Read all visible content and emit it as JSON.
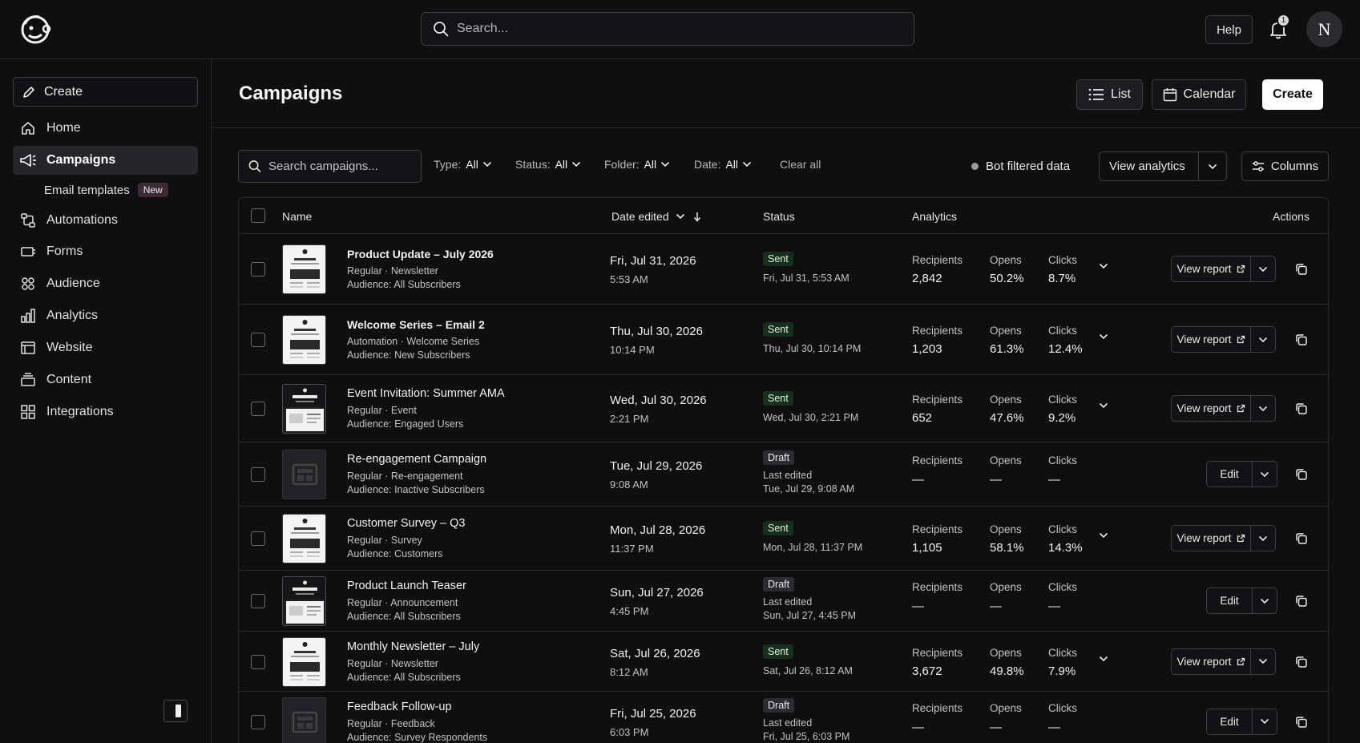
{
  "header": {
    "search_placeholder": "Search...",
    "help_label": "Help",
    "notification_count": "1",
    "avatar_initial": "N"
  },
  "sidebar": {
    "create_label": "Create",
    "items": [
      {
        "label": "Home",
        "icon": "home-icon"
      },
      {
        "label": "Campaigns",
        "icon": "megaphone-icon",
        "active": true
      },
      {
        "label": "Email templates",
        "badge": "New"
      },
      {
        "label": "Automations",
        "icon": "automation-icon"
      },
      {
        "label": "Forms",
        "icon": "form-icon"
      },
      {
        "label": "Audience",
        "icon": "audience-icon"
      },
      {
        "label": "Analytics",
        "icon": "bar-chart-icon"
      },
      {
        "label": "Website",
        "icon": "website-icon"
      },
      {
        "label": "Content",
        "icon": "content-icon"
      },
      {
        "label": "Integrations",
        "icon": "grid-icon"
      }
    ]
  },
  "main": {
    "title": "Campaigns",
    "list_label": "List",
    "calendar_label": "Calendar",
    "create_label": "Create",
    "search_placeholder": "Search campaigns...",
    "filters": [
      {
        "label": "Type:",
        "value": "All"
      },
      {
        "label": "Status:",
        "value": "All"
      },
      {
        "label": "Folder:",
        "value": "All"
      },
      {
        "label": "Date:",
        "value": "All"
      }
    ],
    "clear_all": "Clear all",
    "bot_filtered": "Bot filtered data",
    "view_analytics": "View analytics",
    "columns_label": "Columns"
  },
  "table": {
    "headers": {
      "name": "Name",
      "date_edited": "Date edited",
      "status": "Status",
      "analytics": "Analytics",
      "actions": "Actions"
    },
    "labels": {
      "recipients": "Recipients",
      "opens": "Opens",
      "clicks": "Clicks"
    },
    "rows": [
      {
        "name": "Product Update – July 2026",
        "type": "Regular",
        "category": "Newsletter",
        "audience": "Audience: All Subscribers",
        "date": "Fri, Jul 31, 2026",
        "time": "5:53 AM",
        "status": "Sent",
        "status_line1": "Fri, Jul 31, 5:53 AM",
        "status_line2": "",
        "recipients": "2,842",
        "opens": "50.2%",
        "clicks": "8.7%",
        "action": "View report",
        "thumb": "light"
      },
      {
        "name": "Welcome Series – Email 2",
        "type": "Automation",
        "category": "Welcome Series",
        "audience": "Audience: New Subscribers",
        "date": "Thu, Jul 30, 2026",
        "time": "10:14 PM",
        "status": "Sent",
        "status_line1": "Thu, Jul 30, 10:14 PM",
        "status_line2": "",
        "recipients": "1,203",
        "opens": "61.3%",
        "clicks": "12.4%",
        "action": "View report",
        "thumb": "light"
      },
      {
        "name": "Event Invitation: Summer AMA",
        "type": "Regular",
        "category": "Event",
        "audience": "Audience: Engaged Users",
        "date": "Wed, Jul 30, 2026",
        "time": "2:21 PM",
        "status": "Sent",
        "status_line1": "Wed, Jul 30, 2:21 PM",
        "status_line2": "",
        "recipients": "652",
        "opens": "47.6%",
        "clicks": "9.2%",
        "action": "View report",
        "thumb": "dark"
      },
      {
        "name": "Re-engagement Campaign",
        "type": "Regular",
        "category": "Re-engagement",
        "audience": "Audience: Inactive Subscribers",
        "date": "Tue, Jul 29, 2026",
        "time": "9:08 AM",
        "status": "Draft",
        "status_line1": "Last edited",
        "status_line2": "Tue, Jul 29, 9:08 AM",
        "recipients": "—",
        "opens": "—",
        "clicks": "—",
        "action": "Edit",
        "thumb": "ph"
      },
      {
        "name": "Customer Survey – Q3",
        "type": "Regular",
        "category": "Survey",
        "audience": "Audience: Customers",
        "date": "Mon, Jul 28, 2026",
        "time": "11:37 PM",
        "status": "Sent",
        "status_line1": "Mon, Jul 28, 11:37 PM",
        "status_line2": "",
        "recipients": "1,105",
        "opens": "58.1%",
        "clicks": "14.3%",
        "action": "View report",
        "thumb": "light"
      },
      {
        "name": "Product Launch Teaser",
        "type": "Regular",
        "category": "Announcement",
        "audience": "Audience: All Subscribers",
        "date": "Sun, Jul 27, 2026",
        "time": "4:45 PM",
        "status": "Draft",
        "status_line1": "Last edited",
        "status_line2": "Sun, Jul 27, 4:45 PM",
        "recipients": "—",
        "opens": "—",
        "clicks": "—",
        "action": "Edit",
        "thumb": "dark"
      },
      {
        "name": "Monthly Newsletter – July",
        "type": "Regular",
        "category": "Newsletter",
        "audience": "Audience: All Subscribers",
        "date": "Sat, Jul 26, 2026",
        "time": "8:12 AM",
        "status": "Sent",
        "status_line1": "Sat, Jul 26, 8:12 AM",
        "status_line2": "",
        "recipients": "3,672",
        "opens": "49.8%",
        "clicks": "7.9%",
        "action": "View report",
        "thumb": "light"
      },
      {
        "name": "Feedback Follow-up",
        "type": "Regular",
        "category": "Feedback",
        "audience": "Audience: Survey Respondents",
        "date": "Fri, Jul 25, 2026",
        "time": "6:03 PM",
        "status": "Draft",
        "status_line1": "Last edited",
        "status_line2": "Fri, Jul 25, 6:03 PM",
        "recipients": "—",
        "opens": "—",
        "clicks": "—",
        "action": "Edit",
        "thumb": "ph"
      }
    ]
  }
}
